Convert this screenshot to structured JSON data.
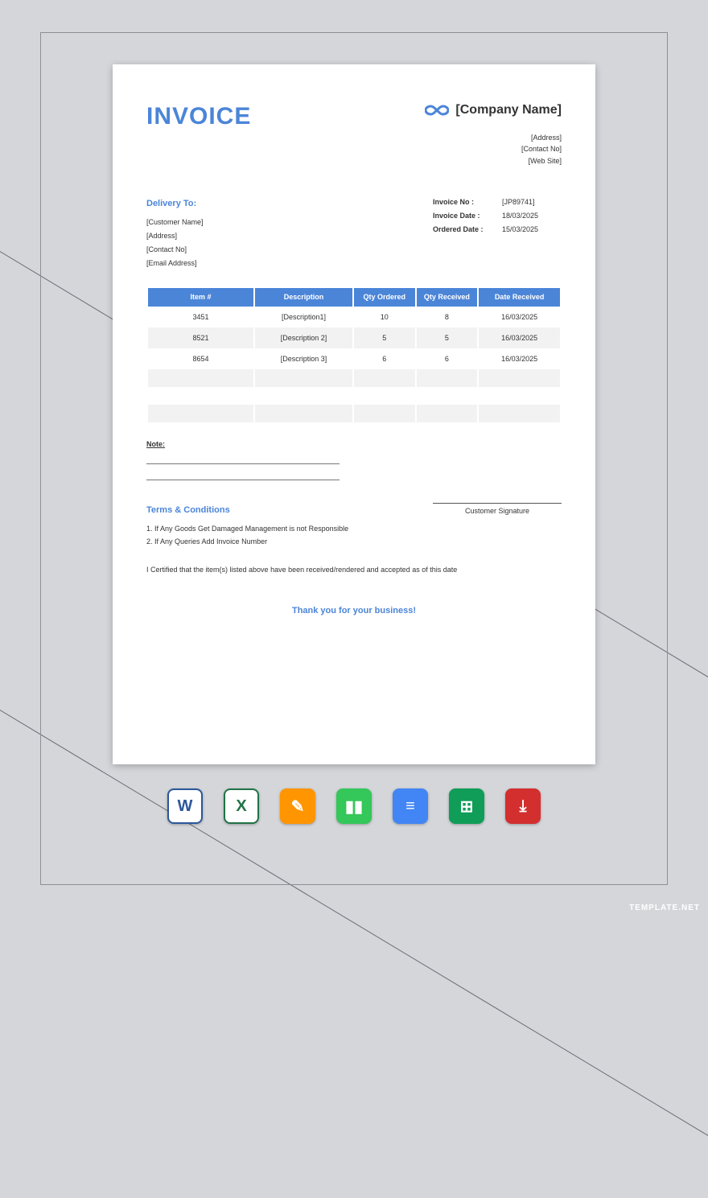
{
  "header": {
    "title": "INVOICE",
    "company_name": "[Company Name]",
    "company_details": [
      "[Address]",
      "[Contact No]",
      "[Web Site]"
    ]
  },
  "delivery": {
    "title": "Delivery To:",
    "fields": [
      "[Customer Name]",
      "[Address]",
      "[Contact No]",
      "[Email Address]"
    ]
  },
  "invoice_meta": [
    {
      "label": "Invoice No",
      "value": "[JP89741]"
    },
    {
      "label": "Invoice Date",
      "value": "18/03/2025"
    },
    {
      "label": "Ordered Date",
      "value": "15/03/2025"
    }
  ],
  "table": {
    "headers": [
      "Item #",
      "Description",
      "Qty Ordered",
      "Qty Received",
      "Date Received"
    ],
    "rows": [
      [
        "3451",
        "[Description1]",
        "10",
        "8",
        "16/03/2025"
      ],
      [
        "8521",
        "[Description 2]",
        "5",
        "5",
        "16/03/2025"
      ],
      [
        "8654",
        "[Description 3]",
        "6",
        "6",
        "16/03/2025"
      ]
    ]
  },
  "note": {
    "label": "Note:"
  },
  "terms": {
    "title": "Terms & Conditions",
    "items": [
      "1. If Any Goods Get Damaged Management is not Responsible",
      "2. If Any Queries Add Invoice Number"
    ]
  },
  "signature": {
    "label": "Customer Signature"
  },
  "certification": "I Certified that the item(s) listed above have been received/rendered and accepted as of this date",
  "thanks": "Thank you for your business!",
  "watermark": "TEMPLATE.NET",
  "app_icons": [
    {
      "name": "word-icon",
      "bg": "#ffffff",
      "glyph": "W",
      "glyph_color": "#2b579a",
      "border": "#2b579a"
    },
    {
      "name": "excel-icon",
      "bg": "#ffffff",
      "glyph": "X",
      "glyph_color": "#217346",
      "border": "#217346"
    },
    {
      "name": "pages-icon",
      "bg": "#ff9500",
      "glyph": "✎",
      "glyph_color": "#ffffff",
      "border": "#ff9500"
    },
    {
      "name": "numbers-icon",
      "bg": "#34c759",
      "glyph": "▮▮",
      "glyph_color": "#ffffff",
      "border": "#34c759"
    },
    {
      "name": "gdocs-icon",
      "bg": "#4285f4",
      "glyph": "≡",
      "glyph_color": "#ffffff",
      "border": "#4285f4"
    },
    {
      "name": "gsheets-icon",
      "bg": "#0f9d58",
      "glyph": "⊞",
      "glyph_color": "#ffffff",
      "border": "#0f9d58"
    },
    {
      "name": "pdf-icon",
      "bg": "#d32f2f",
      "glyph": "⤓",
      "glyph_color": "#ffffff",
      "border": "#d32f2f"
    }
  ]
}
